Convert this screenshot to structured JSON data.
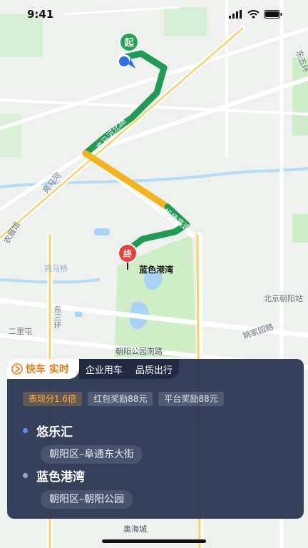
{
  "status_bar": {
    "time": "9:41"
  },
  "map": {
    "start_marker": "起",
    "end_marker": "终",
    "destination_label": "蓝色港湾",
    "road_labels": [
      "东五环",
      "北京朝阳站",
      "姚家园路",
      "朝阳公园南路",
      "亮马桥",
      "二里屯",
      "东三环",
      "亮马河",
      "亮马河北路",
      "机场高速",
      "农展馆",
      "奥海城"
    ]
  },
  "card": {
    "tabs": [
      {
        "label": "快车 实时",
        "active": true
      },
      {
        "label": "企业用车",
        "active": false
      },
      {
        "label": "品质出行",
        "active": false
      }
    ],
    "chips": [
      "表现分1.6倍",
      "红包奖励88元",
      "平台奖励88元"
    ],
    "origin": {
      "name": "悠乐汇",
      "address": "朝阳区–阜通东大街",
      "dot_color": "#5a8cff"
    },
    "destination": {
      "name": "蓝色港湾",
      "address": "朝阳区–朝阳公园",
      "dot_color": "#9aa6c4"
    }
  },
  "colors": {
    "route_green": "#1f9b55",
    "route_yellow": "#f4b41a",
    "end_marker": "#e8423c",
    "start_marker": "#22a550",
    "tab_accent": "#f07c14"
  },
  "icons": [
    "signal-icon",
    "wifi-icon",
    "battery-icon",
    "location-dot-icon",
    "flag-icon"
  ]
}
